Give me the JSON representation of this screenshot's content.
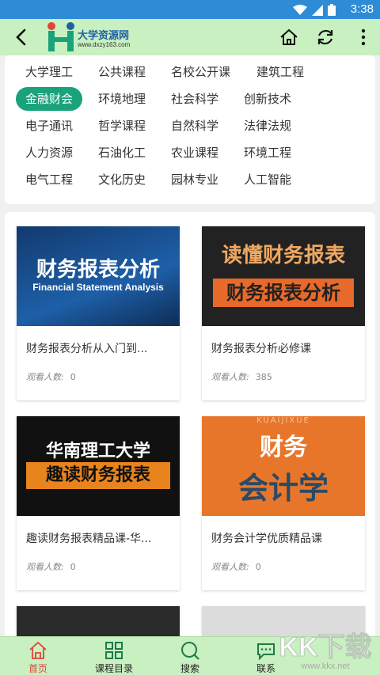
{
  "status": {
    "time": "3:38"
  },
  "header": {
    "logo_title": "大学资源网",
    "logo_url": "www.dxzy163.com"
  },
  "categories": [
    "大学理工",
    "公共课程",
    "名校公开课",
    "建筑工程",
    "金融财会",
    "环境地理",
    "社会科学",
    "创新技术",
    "电子通讯",
    "哲学课程",
    "自然科学",
    "法律法规",
    "人力资源",
    "石油化工",
    "农业课程",
    "环境工程",
    "电气工程",
    "文化历史",
    "园林专业",
    "人工智能"
  ],
  "active_category": "金融财会",
  "views_label": "观看人数:",
  "courses": [
    {
      "title": "财务报表分析从入门到...",
      "views": "0",
      "thumb_text": "财务报表分析",
      "thumb_sub": "Financial Statement Analysis"
    },
    {
      "title": "财务报表分析必修课",
      "views": "385",
      "thumb_text": "读懂财务报表",
      "thumb_sub": "财务报表分析"
    },
    {
      "title": "趣读财务报表精品课-华...",
      "views": "0",
      "thumb_text": "华南理工大学",
      "thumb_sub": "趣读财务报表"
    },
    {
      "title": "财务会计学优质精品课",
      "views": "0",
      "thumb_text": "财务",
      "thumb_sub": "会计学",
      "thumb_top": "KUAIJIXUE"
    }
  ],
  "nav": [
    {
      "label": "首页",
      "icon": "home-icon"
    },
    {
      "label": "课程目录",
      "icon": "grid-icon"
    },
    {
      "label": "搜索",
      "icon": "search-icon"
    },
    {
      "label": "联系",
      "icon": "chat-icon"
    }
  ],
  "watermark": {
    "text": "KK下载",
    "url": "www.kkx.net"
  }
}
